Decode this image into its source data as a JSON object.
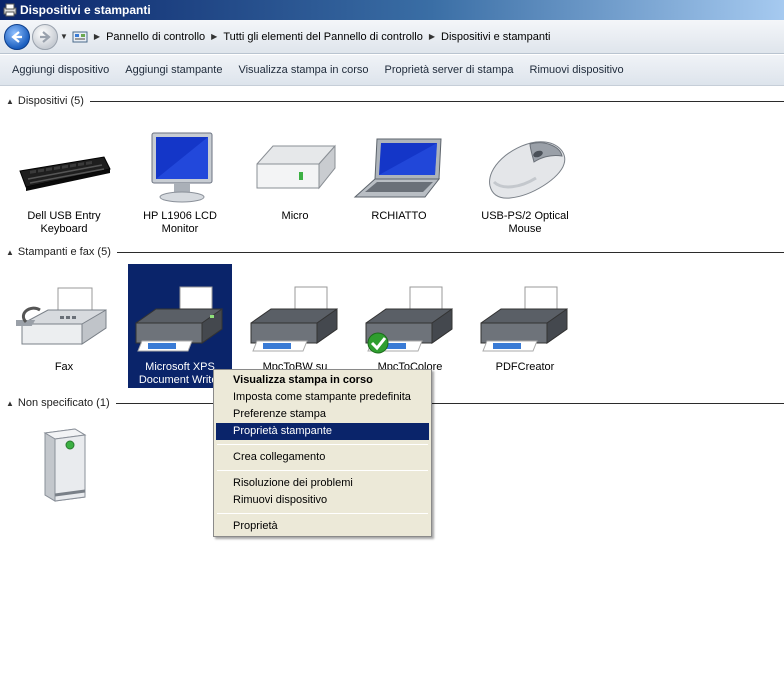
{
  "window": {
    "title": "Dispositivi e stampanti"
  },
  "address": {
    "crumbs": [
      "Pannello di controllo",
      "Tutti gli elementi del Pannello di controllo",
      "Dispositivi e stampanti"
    ]
  },
  "toolbar": {
    "buttons": [
      "Aggiungi dispositivo",
      "Aggiungi stampante",
      "Visualizza stampa in corso",
      "Proprietà server di stampa",
      "Rimuovi dispositivo"
    ]
  },
  "groups": {
    "devices": {
      "header": "Dispositivi (5)",
      "items": [
        {
          "label": "Dell USB Entry Keyboard",
          "icon": "keyboard-icon"
        },
        {
          "label": "HP L1906 LCD Monitor",
          "icon": "monitor-icon"
        },
        {
          "label": "Micro",
          "icon": "hard-drive-icon"
        },
        {
          "label": "RCHIATTO",
          "icon": "laptop-icon"
        },
        {
          "label": "USB-PS/2 Optical Mouse",
          "icon": "mouse-icon"
        }
      ]
    },
    "printers": {
      "header": "Stampanti e fax (5)",
      "items": [
        {
          "label": "Fax",
          "icon": "fax-icon"
        },
        {
          "label": "Microsoft XPS Document Writer",
          "icon": "printer-icon"
        },
        {
          "label": "MpcToBW su",
          "icon": "printer-icon"
        },
        {
          "label": "MpcToColore",
          "icon": "printer-default-icon"
        },
        {
          "label": "PDFCreator",
          "icon": "printer-icon"
        }
      ]
    },
    "unspecified": {
      "header": "Non specificato (1)",
      "items": [
        {
          "label": "",
          "icon": "computer-tower-icon"
        }
      ]
    }
  },
  "context_menu": {
    "items": [
      {
        "label": "Visualizza stampa in corso",
        "bold": true
      },
      {
        "label": "Imposta come stampante predefinita"
      },
      {
        "label": "Preferenze stampa"
      },
      {
        "label": "Proprietà stampante",
        "highlighted": true
      },
      {
        "label": "Crea collegamento"
      },
      {
        "label": "Risoluzione dei problemi"
      },
      {
        "label": "Rimuovi dispositivo"
      },
      {
        "label": "Proprietà"
      }
    ]
  }
}
